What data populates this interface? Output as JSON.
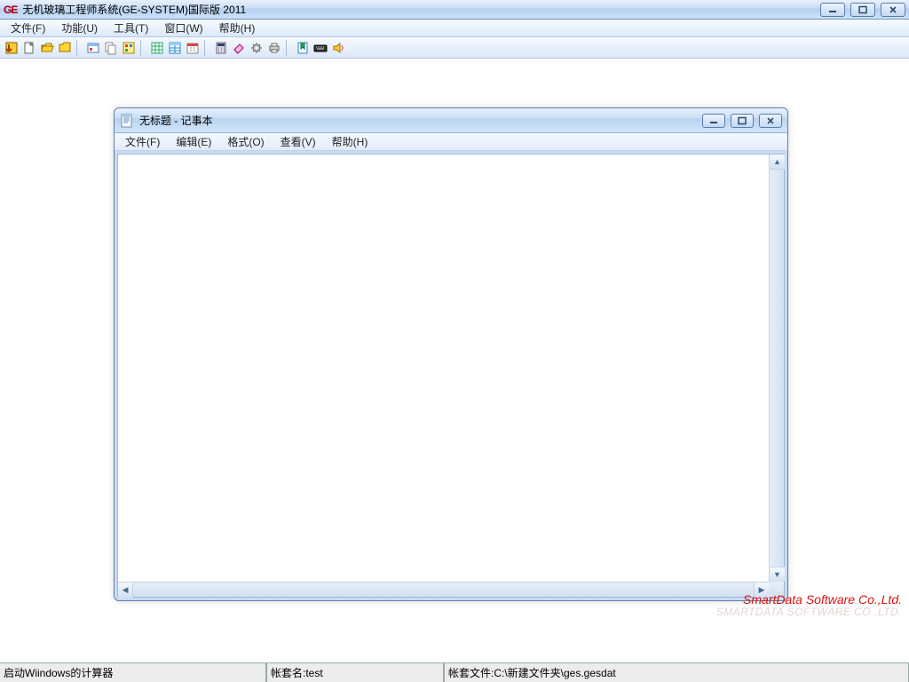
{
  "app": {
    "logo_text": "GE",
    "title": "无机玻璃工程师系统(GE-SYSTEM)国际版 2011",
    "menu": [
      "文件(F)",
      "功能(U)",
      "工具(T)",
      "窗口(W)",
      "帮助(H)"
    ],
    "toolbar_icons": [
      "exit-icon",
      "new-icon",
      "open-icon",
      "folder-icon",
      "sep",
      "db-icon",
      "copy-icon",
      "module-icon",
      "sep",
      "grid-icon",
      "table-icon",
      "calendar-icon",
      "sep",
      "calc-icon",
      "eraser-icon",
      "gear-icon",
      "print-icon",
      "sep",
      "bookmark-icon",
      "keyboard-icon",
      "sound-icon"
    ],
    "branding": "SmartData Software Co.,Ltd.",
    "branding_shadow": "SMARTDATA SOFTWARE CO.,LTD."
  },
  "notepad": {
    "title": "无标题 - 记事本",
    "menu": [
      "文件(F)",
      "编辑(E)",
      "格式(O)",
      "查看(V)",
      "帮助(H)"
    ],
    "content": ""
  },
  "status": {
    "cell1": "启动Wiindows的计算器",
    "cell2": "帐套名:test",
    "cell3": "帐套文件:C:\\新建文件夹\\ges.gesdat"
  },
  "icon_svg": {
    "exit-icon": "<rect x='2' y='2' width='12' height='12' fill='#ffcc33' stroke='#806000'/><path d='M5 4 L5 12 M5 12 L8 9 M5 12 L2 9' stroke='#a04000' stroke-width='2' fill='none'/>",
    "new-icon": "<rect x='3' y='2' width='9' height='12' fill='#fff' stroke='#666'/><path d='M9 2 L12 5 L9 5 Z' fill='#ddd' stroke='#666'/>",
    "open-icon": "<path d='M2 5 L6 5 L7 3 L13 3 L13 12 L2 12 Z' fill='#ffe066' stroke='#a07000'/><path d='M3 6 L15 6 L13 12 L2 12 Z' fill='#ffd633' stroke='#a07000'/>",
    "folder-icon": "<path d='M2 4 L6 4 L7 2 L14 2 L14 12 L2 12 Z' fill='#ffd633' stroke='#a07000'/>",
    "db-icon": "<rect x='2' y='3' width='12' height='10' fill='#fff' stroke='#5577aa'/><rect x='2' y='3' width='12' height='3' fill='#88bbee'/><rect x='4' y='8' width='3' height='3' fill='#d44'/>",
    "copy-icon": "<rect x='2' y='2' width='8' height='10' fill='#fff' stroke='#888'/><rect x='5' y='5' width='8' height='10' fill='#fff' stroke='#888'/>",
    "module-icon": "<rect x='2' y='2' width='12' height='12' fill='#ffec99' stroke='#aa8800'/><rect x='4' y='4' width='3' height='3' fill='#d44'/><rect x='9' y='4' width='3' height='3' fill='#28c'/><rect x='4' y='9' width='3' height='3' fill='#2a4'/>",
    "grid-icon": "<rect x='2' y='2' width='12' height='12' fill='#fff' stroke='#2a6'/><path d='M2 6 H14 M2 10 H14 M6 2 V14 M10 2 V14' stroke='#2a6'/>",
    "table-icon": "<rect x='2' y='2' width='12' height='12' fill='#fff' stroke='#28c'/><rect x='2' y='2' width='12' height='3' fill='#9cf'/><path d='M2 8 H14 M2 11 H14 M8 5 V14' stroke='#28c'/>",
    "calendar-icon": "<rect x='2' y='3' width='12' height='11' fill='#fff' stroke='#888'/><rect x='2' y='3' width='12' height='3' fill='#d44'/><path d='M5 8 H7 M9 8 H11 M5 11 H7 M9 11 H11' stroke='#888'/>",
    "calc-icon": "<rect x='3' y='2' width='10' height='12' fill='#dde' stroke='#667'/><rect x='4' y='3' width='8' height='3' fill='#346' /><path d='M5 8 H6 M8 8 H9 M11 8 H12 M5 10 H6 M8 10 H9 M11 10 H12 M5 12 H6 M8 12 H9 M11 12 H12' stroke='#667'/>",
    "eraser-icon": "<path d='M3 10 L9 4 L13 8 L7 14 Z' fill='#fbd' stroke='#a07'/><path d='M3 10 L7 14' stroke='#a07'/>",
    "gear-icon": "<circle cx='8' cy='8' r='4' fill='#bbb' stroke='#666'/><circle cx='8' cy='8' r='1.5' fill='#fff'/><path d='M8 2 V4 M8 12 V14 M2 8 H4 M12 8 H14 M4 4 L5.5 5.5 M12 12 L10.5 10.5 M4 12 L5.5 10.5 M12 4 L10.5 5.5' stroke='#666'/>",
    "print-icon": "<rect x='3' y='6' width='10' height='5' fill='#ccc' stroke='#666'/><rect x='5' y='3' width='6' height='3' fill='#fff' stroke='#666'/><rect x='5' y='10' width='6' height='3' fill='#fff' stroke='#666'/>",
    "bookmark-icon": "<rect x='3' y='2' width='10' height='12' fill='#fff' stroke='#28c'/><path d='M6 2 V9 L8 7 L10 9 V2' fill='#2a6' stroke='#164'/>",
    "keyboard-icon": "<rect x='1' y='5' width='14' height='7' rx='1' fill='#333' stroke='#000'/><path d='M3 7 H4 M5 7 H6 M7 7 H8 M9 7 H10 M11 7 H12 M4 9 H12' stroke='#ddd'/>",
    "sound-icon": "<path d='M3 6 L6 6 L10 3 L10 13 L6 10 L3 10 Z' fill='#ffcc33' stroke='#a07000'/><path d='M12 5 Q14 8 12 11' stroke='#d44' fill='none'/>",
    "notepad-doc": "<rect x='2' y='1' width='11' height='14' fill='#fff' stroke='#6a8fb8'/><path d='M4 4 H11 M4 6 H11 M4 8 H11 M4 10 H9' stroke='#6a8fb8'/><rect x='2' y='1' width='11' height='2' fill='#a9cdee'/>"
  }
}
